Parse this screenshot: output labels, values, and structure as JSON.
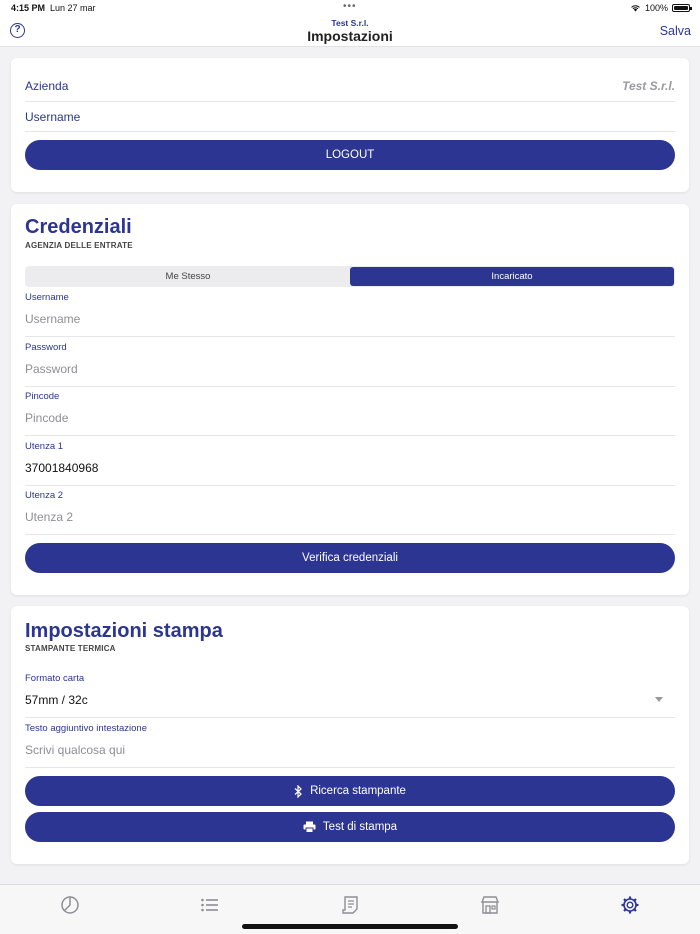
{
  "status": {
    "time": "4:15 PM",
    "date": "Lun 27 mar",
    "dots": "•••",
    "battery": "100%"
  },
  "nav": {
    "subtitle": "Test S.r.l.",
    "title": "Impostazioni",
    "save": "Salva",
    "help": "?"
  },
  "account": {
    "company_label": "Azienda",
    "company_value": "Test S.r.l.",
    "username_label": "Username",
    "logout": "LOGOUT"
  },
  "credentials": {
    "title": "Credenziali",
    "subtitle": "AGENZIA DELLE ENTRATE",
    "segments": [
      "Me Stesso",
      "Incaricato"
    ],
    "selected_segment": "Incaricato",
    "fields": [
      {
        "label": "Username",
        "value": "",
        "placeholder": "Username"
      },
      {
        "label": "Password",
        "value": "",
        "placeholder": "Password"
      },
      {
        "label": "Pincode",
        "value": "",
        "placeholder": "Pincode"
      },
      {
        "label": "Utenza 1",
        "value": "37001840968",
        "placeholder": ""
      },
      {
        "label": "Utenza 2",
        "value": "",
        "placeholder": "Utenza 2"
      }
    ],
    "verify": "Verifica credenziali"
  },
  "print": {
    "title": "Impostazioni stampa",
    "subtitle": "STAMPANTE TERMICA",
    "paper_label": "Formato carta",
    "paper_value": "57mm / 32c",
    "header_label": "Testo aggiuntivo intestazione",
    "header_placeholder": "Scrivi qualcosa qui",
    "search_printer": "Ricerca stampante",
    "test_print": "Test di stampa"
  },
  "tabs": [
    "dashboard-icon",
    "list-icon",
    "receipt-icon",
    "store-icon",
    "settings-icon"
  ],
  "colors": {
    "accent": "#2c3592",
    "inactive_tab": "#8e8e94"
  }
}
